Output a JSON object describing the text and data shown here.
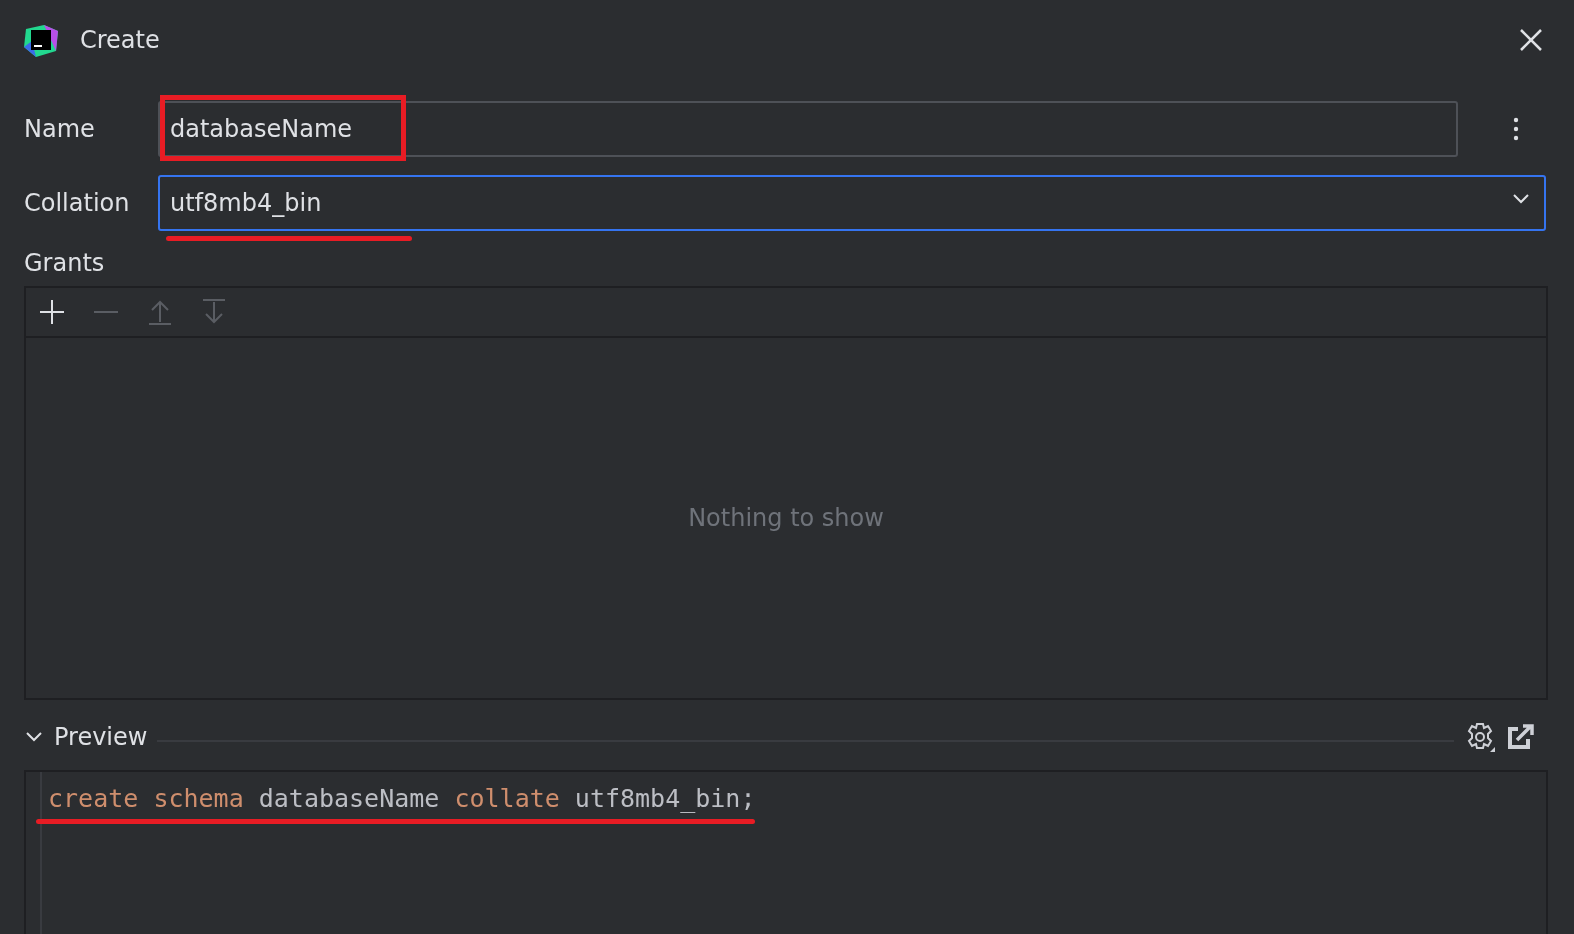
{
  "window": {
    "title": "Create"
  },
  "name_field": {
    "label": "Name",
    "value": "databaseName",
    "boxed": true
  },
  "collation_field": {
    "label": "Collation",
    "value": "utf8mb4_bin",
    "focused": true,
    "underlined": true
  },
  "grants": {
    "label": "Grants",
    "toolbar": [
      {
        "kind": "add",
        "disabled": false
      },
      {
        "kind": "remove",
        "disabled": true
      },
      {
        "kind": "up",
        "disabled": true
      },
      {
        "kind": "down",
        "disabled": true
      }
    ],
    "empty_text": "Nothing to show"
  },
  "preview": {
    "label": "Preview",
    "expanded": true,
    "underlined": true,
    "code": [
      {
        "kind": "keyword",
        "text": "create"
      },
      {
        "kind": "keyword",
        "text": "schema"
      },
      {
        "kind": "identifier",
        "text": "databaseName"
      },
      {
        "kind": "keyword",
        "text": "collate"
      },
      {
        "kind": "identifier",
        "text": "utf8mb4_bin;"
      }
    ]
  }
}
